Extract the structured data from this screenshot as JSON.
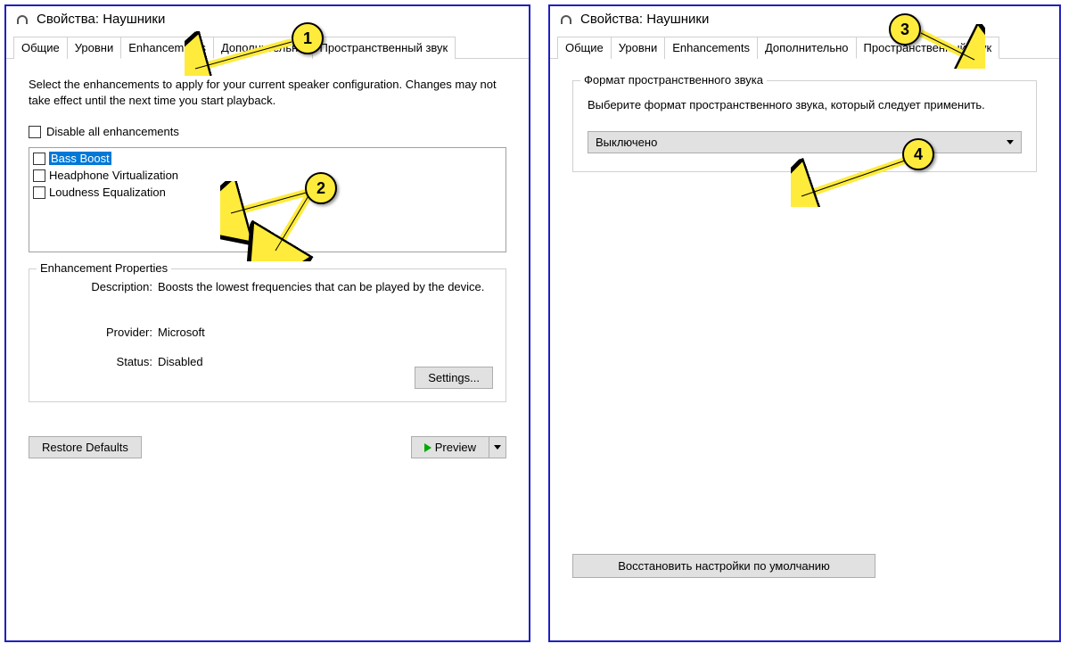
{
  "left": {
    "title": "Свойства: Наушники",
    "tabs": [
      "Общие",
      "Уровни",
      "Enhancements",
      "Дополнительно",
      "Пространственный звук"
    ],
    "active_tab": 2,
    "description": "Select the enhancements to apply for your current speaker configuration. Changes may not take effect until the next time you start playback.",
    "disable_all": "Disable all enhancements",
    "items": [
      {
        "label": "Bass Boost",
        "selected": true
      },
      {
        "label": "Headphone Virtualization",
        "selected": false
      },
      {
        "label": "Loudness Equalization",
        "selected": false
      }
    ],
    "props_title": "Enhancement Properties",
    "desc_label": "Description:",
    "desc_value": "Boosts the lowest frequencies that can be played by the device.",
    "provider_label": "Provider:",
    "provider_value": "Microsoft",
    "status_label": "Status:",
    "status_value": "Disabled",
    "settings_btn": "Settings...",
    "restore_btn": "Restore Defaults",
    "preview_btn": "Preview"
  },
  "right": {
    "title": "Свойства: Наушники",
    "tabs": [
      "Общие",
      "Уровни",
      "Enhancements",
      "Дополнительно",
      "Пространственный звук"
    ],
    "active_tab": 4,
    "group_title": "Формат пространственного звука",
    "group_text": "Выберите формат пространственного звука, который следует применить.",
    "dropdown_value": "Выключено",
    "restore_btn": "Восстановить настройки по умолчанию"
  },
  "callouts": [
    "1",
    "2",
    "3",
    "4"
  ]
}
